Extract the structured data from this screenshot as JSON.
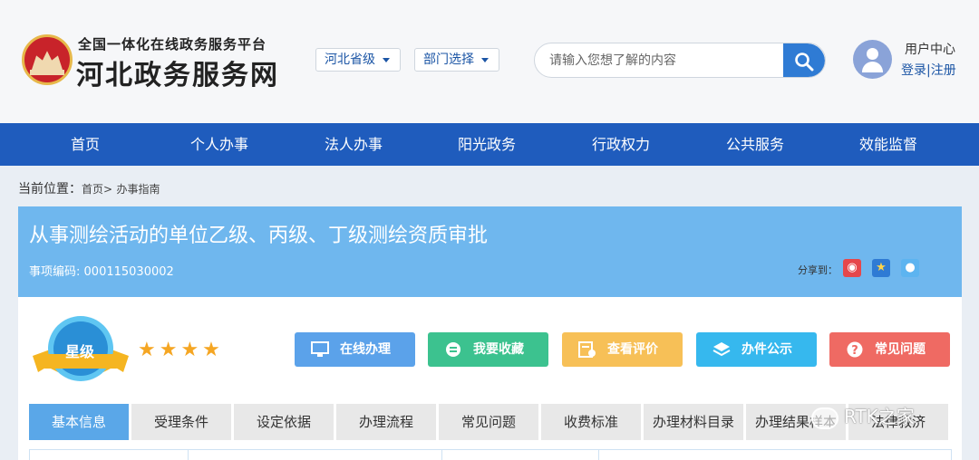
{
  "header": {
    "platform_subtitle": "全国一体化在线政务服务平台",
    "site_name": "河北政务服务网",
    "region_dropdown": "河北省级",
    "department_dropdown": "部门选择",
    "search_placeholder": "请输入您想了解的内容",
    "user_center": "用户中心",
    "login_register": "登录|注册"
  },
  "nav": {
    "items": [
      "首页",
      "个人办事",
      "法人办事",
      "阳光政务",
      "行政权力",
      "公共服务",
      "效能监督"
    ]
  },
  "breadcrumb": {
    "prefix": "当前位置：",
    "home": "首页>",
    "current": "办事指南"
  },
  "item": {
    "title": "从事测绘活动的单位乙级、丙级、丁级测绘资质审批",
    "code_label": "事项编码:",
    "code": "000115030002",
    "share_label": "分享到：",
    "rating_badge": "星级",
    "rating_stars": 4,
    "stars_text": "★★★★"
  },
  "actions": [
    {
      "label": "在线办理",
      "icon": "monitor-icon",
      "color": "#5ba2ea"
    },
    {
      "label": "我要收藏",
      "icon": "bookmark-icon",
      "color": "#3cc28f"
    },
    {
      "label": "查看评价",
      "icon": "review-icon",
      "color": "#f7c057"
    },
    {
      "label": "办件公示",
      "icon": "layers-icon",
      "color": "#36b8ee"
    },
    {
      "label": "常见问题",
      "icon": "question-icon",
      "color": "#ef6a63"
    }
  ],
  "tabs": [
    "基本信息",
    "受理条件",
    "设定依据",
    "办理流程",
    "常见问题",
    "收费标准",
    "办理材料目录",
    "办理结果样本",
    "法律救济"
  ],
  "watermark": "RTK之家",
  "colors": {
    "nav_bg": "#1f5cbd",
    "title_band": "#6fb7ee",
    "active_tab": "#5aa7e8"
  }
}
